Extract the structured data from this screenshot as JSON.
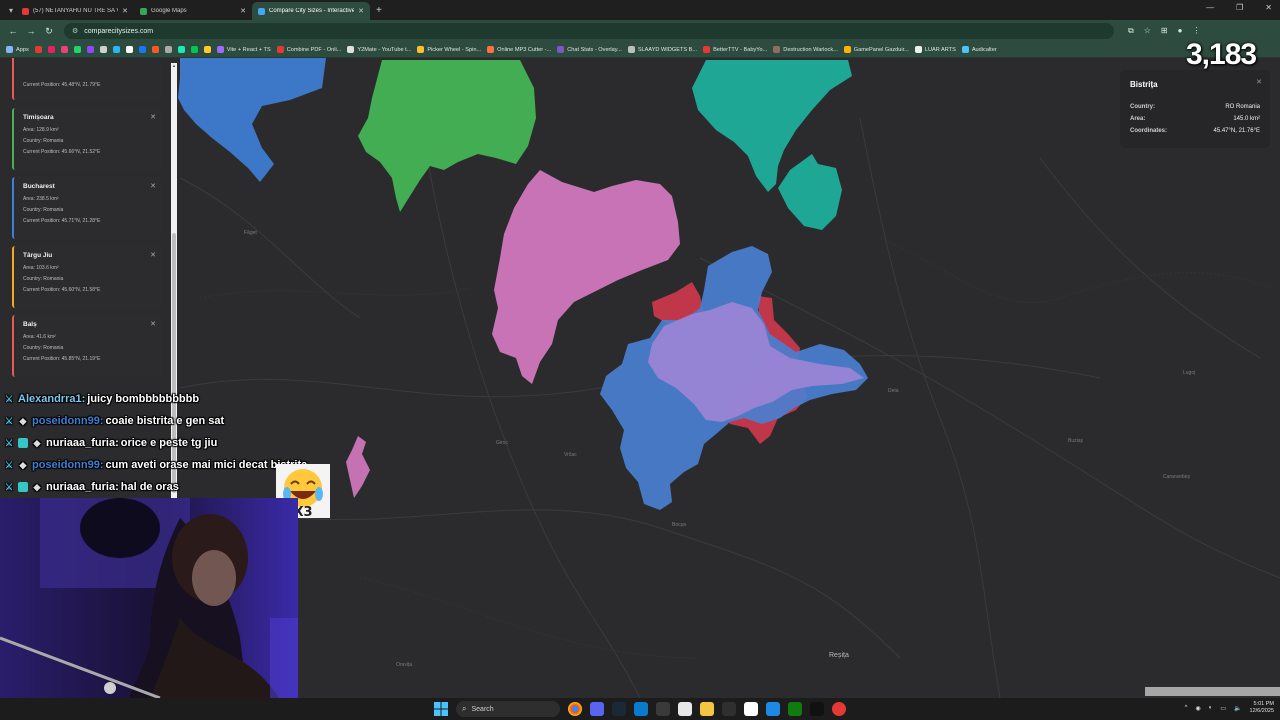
{
  "browser": {
    "tabs": [
      {
        "title": "(57) NETANYAHU NU TRE SA V...",
        "favicon_color": "#e53935",
        "active": false
      },
      {
        "title": "Google Maps",
        "favicon_color": "#34a853",
        "active": false
      },
      {
        "title": "Compare City Sizes - Interactive",
        "favicon_color": "#42a5f5",
        "active": true
      }
    ],
    "url": "comparecitysizes.com",
    "bookmarks": [
      {
        "label": "Apps",
        "color": "#8ab4f8"
      },
      {
        "label": "Vite + React + TS",
        "color": "#9c6bff"
      },
      {
        "label": "Combine PDF - Onli...",
        "color": "#e53935"
      },
      {
        "label": "Y2Mate - YouTube t...",
        "color": "#e0e0e0"
      },
      {
        "label": "Picker Wheel - Spin...",
        "color": "#fbc02d"
      },
      {
        "label": "Online MP3 Cutter -...",
        "color": "#ff7043"
      },
      {
        "label": "Chat Stats - Overlay...",
        "color": "#7e57c2"
      },
      {
        "label": "SLAAYD WIDGETS B...",
        "color": "#bdbdbd"
      },
      {
        "label": "BetterTTV - BabyYo...",
        "color": "#e53935"
      },
      {
        "label": "Destruction Warlock...",
        "color": "#8d6e63"
      },
      {
        "label": "GamePanel Gazduir...",
        "color": "#ffb300"
      },
      {
        "label": "LUAR ARTS",
        "color": "#eeeeee"
      },
      {
        "label": "Audicalter",
        "color": "#4fc3f7"
      }
    ]
  },
  "viewer_count": "3,183",
  "sidebar": {
    "partial_top_line": "Current Position: 45.48°N, 21.79°E",
    "field_labels": {
      "area": "Area:",
      "country": "Country:",
      "position": "Current Position:"
    },
    "cities": [
      {
        "name": "Timișoara",
        "area": "Area: 128.9 km²",
        "country": "Country: Romania",
        "position": "Current Position: 45.66°N, 21.52°E",
        "color": "#4caf50"
      },
      {
        "name": "Bucharest",
        "area": "Area: 238.5 km²",
        "country": "Country: Romania",
        "position": "Current Position: 45.71°N, 21.28°E",
        "color": "#3f7fd6"
      },
      {
        "name": "Târgu Jiu",
        "area": "Area: 103.6 km²",
        "country": "Country: Romania",
        "position": "Current Position: 45.60°N, 21.58°E",
        "color": "#f5a623"
      },
      {
        "name": "Balș",
        "area": "Area: 41.6 km²",
        "country": "Country: Romania",
        "position": "Current Position: 45.85°N, 21.19°E",
        "color": "#e75a5a"
      }
    ]
  },
  "info_card": {
    "title": "Bistrița",
    "rows": [
      {
        "key": "Country:",
        "value": "RO Romania"
      },
      {
        "key": "Area:",
        "value": "145.0 km²"
      },
      {
        "key": "Coordinates:",
        "value": "45.47°N, 21.76°E"
      }
    ]
  },
  "chat": [
    {
      "user": "Alexandrra1:",
      "message": "juicy bombbbbbbbbb",
      "user_color": "#7ec8f0"
    },
    {
      "user": "poseidonn99:",
      "message": "coaie bistrita e gen sat",
      "user_color": "#3f7fd6"
    },
    {
      "user": "nuriaaa_furia:",
      "message": "orice e peste tg jiu",
      "user_color": "#f0f0f0"
    },
    {
      "user": "poseidonn99:",
      "message": "cum aveti orase mai mici decat bistrita",
      "user_color": "#3f7fd6"
    },
    {
      "user": "nuriaaa_furia:",
      "message": "hal de oras",
      "user_color": "#f0f0f0"
    }
  ],
  "emote_label": "X3",
  "map_places": [
    {
      "name": "Reșița",
      "big": true
    },
    {
      "name": "Caransebeș",
      "big": false
    },
    {
      "name": "Lugoj",
      "big": false
    },
    {
      "name": "Buziaș",
      "big": false
    },
    {
      "name": "Deta",
      "big": false
    },
    {
      "name": "Bocșa",
      "big": false
    },
    {
      "name": "Vršac",
      "big": false
    },
    {
      "name": "Giroc",
      "big": false
    },
    {
      "name": "Oravița",
      "big": false
    },
    {
      "name": "Făget",
      "big": false
    }
  ],
  "taskbar": {
    "search_label": "Search",
    "time": "5:01 PM",
    "date": "12/6/2025"
  }
}
